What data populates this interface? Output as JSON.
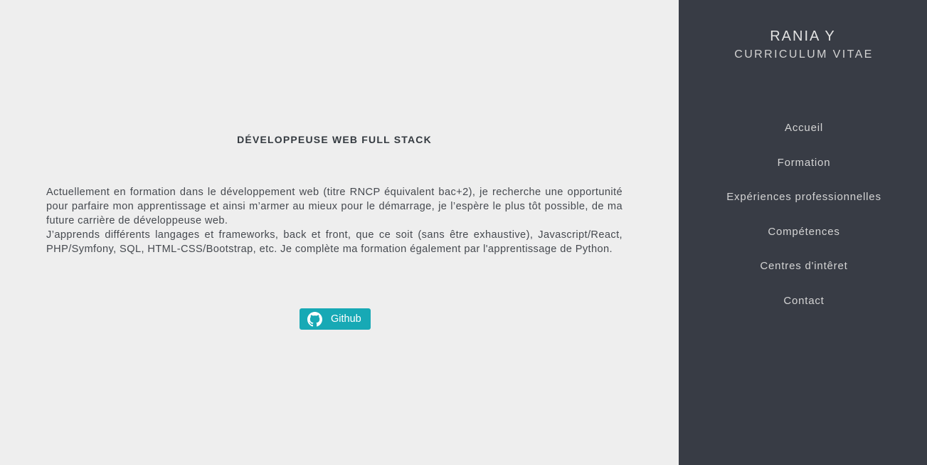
{
  "main": {
    "title": "DÉVELOPPEUSE WEB FULL STACK",
    "paragraph_1": "Actuellement en formation dans le développement web (titre RNCP équivalent bac+2), je recherche une opportunité pour parfaire mon apprentissage et ainsi m’armer au mieux pour le démarrage, je l’espère le plus tôt possible, de ma future carrière de développeuse web.",
    "paragraph_2": "J’apprends différents langages et frameworks, back et front, que ce soit (sans être exhaustive), Javascript/React, PHP/Symfony, SQL, HTML-CSS/Bootstrap, etc. Je complète ma formation également par l'apprentissage de Python.",
    "github_button": {
      "label": "Github",
      "icon": "github-icon",
      "color": "#17a9b5"
    }
  },
  "sidebar": {
    "name": "RANIA Y",
    "subtitle": "CURRICULUM VITAE",
    "background": "#383c45",
    "nav": [
      {
        "label": "Accueil"
      },
      {
        "label": "Formation"
      },
      {
        "label": "Expériences professionnelles"
      },
      {
        "label": "Compétences"
      },
      {
        "label": "Centres d'intêret"
      },
      {
        "label": "Contact"
      }
    ]
  }
}
